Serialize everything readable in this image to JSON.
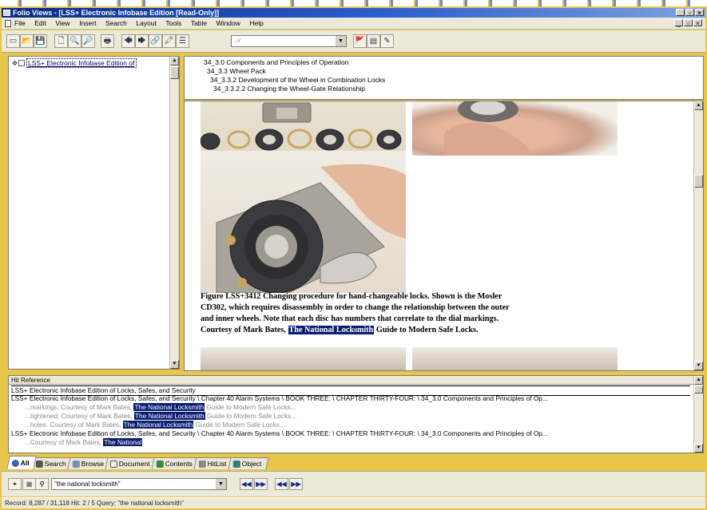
{
  "window": {
    "title": "Folio Views - [LSS+ Electronic Infobase Edition  [Read-Only]]",
    "controls": [
      "_",
      "▫",
      "×"
    ]
  },
  "menu": {
    "items": [
      "File",
      "Edit",
      "View",
      "Insert",
      "Search",
      "Layout",
      "Tools",
      "Table",
      "Window",
      "Help"
    ]
  },
  "toolbar": {
    "icons": [
      "new-icon",
      "open-icon",
      "save-icon",
      "print-preview-icon",
      "find-icon",
      "print-icon",
      "back-icon",
      "forward-icon",
      "link-icon",
      "highlight-icon",
      "contents-icon",
      "style-icon",
      "bookmark-icon",
      "note-icon",
      "popup-icon"
    ],
    "style_value": "",
    "glyphs": {
      "new": "▭",
      "open": "📂",
      "save": "💾",
      "preview": "🗋",
      "find": "🔍",
      "zoom": "🔎",
      "print": "🖶",
      "back": "🡄",
      "forward": "🡆",
      "link": "🔗",
      "highlight": "🖍",
      "contents": "☰",
      "style": "𝒜",
      "bookmark": "🚩",
      "note": "▤",
      "popup": "✎"
    }
  },
  "tree": {
    "root_label": "LSS+ Electronic Infobase Edition of"
  },
  "breadcrumbs": [
    "34_3.0 Components and Principles of Operation",
    "34_3.3 Wheel Pack",
    "34_3.3.2  Development of the Wheel in Combination Locks",
    "34_3.3.2.2 Changing the Wheel-Gate Relationship"
  ],
  "document": {
    "caption_line1": "Figure LSS+3412 Changing procedure for hand-changeable locks. Shown is the Mosler",
    "caption_line2": "CD302, which requires disassembly in order to change the relationship between the outer",
    "caption_line3": "and inner wheels. Note that each disc has numbers that correlate to the dial markings.",
    "caption_line4_pre": "Courtesy of Mark Bates, ",
    "caption_highlight": "The National Locksmith",
    "caption_line4_post": " Guide to Modern Safe Locks."
  },
  "hit_reference": {
    "header": "Hit Reference",
    "selected": "LSS+ Electronic Infobase Edition of Locks, Safes, and Security",
    "path1": "LSS+ Electronic Infobase Edition of Locks, Safes, and Security \\ Chapter 40 Alarm Systems  \\ BOOK THREE:  \\ CHAPTER THIRTY-FOUR:  \\ 34_3.0 Components and Principles of Op...",
    "hits": [
      {
        "pre": "...markings. Courtesy of Mark Bates, ",
        "hl": "The National Locksmith",
        "post": " Guide to Modern Safe Locks..."
      },
      {
        "pre": "...tightened. Courtesy of Mark Bates, ",
        "hl": "The National Locksmith",
        "post": " Guide to Modern Safe Locks..."
      },
      {
        "pre": "...holes. Courtesy of Mark Bates, ",
        "hl": "The National Locksmith",
        "post": " Guide to Modern Safe Locks..."
      }
    ],
    "path2": "LSS+ Electronic Infobase Edition of Locks, Safes, and Security \\ Chapter 40 Alarm Systems  \\ BOOK THREE:  \\ CHAPTER THIRTY-FOUR:  \\ 34_3.0 Components and Principles of Op...",
    "partial_pre": "...Courtesy of Mark Bates, ",
    "partial_hl": "The National"
  },
  "tabs": [
    "All",
    "Search",
    "Browse",
    "Document",
    "Contents",
    "HitList",
    "Object"
  ],
  "query": {
    "value": "\"the national locksmith\"",
    "nav": [
      "◀◀",
      "▶▶",
      "◀◀",
      "▶▶"
    ]
  },
  "status": {
    "text": "Record: 8,287 / 31,118   Hit: 2 / 5   Query: \"the national locksmith\""
  },
  "colors": {
    "highlight": "#0b1d70",
    "frame": "#e8c64a",
    "titlebar": "#0a2a8a"
  }
}
